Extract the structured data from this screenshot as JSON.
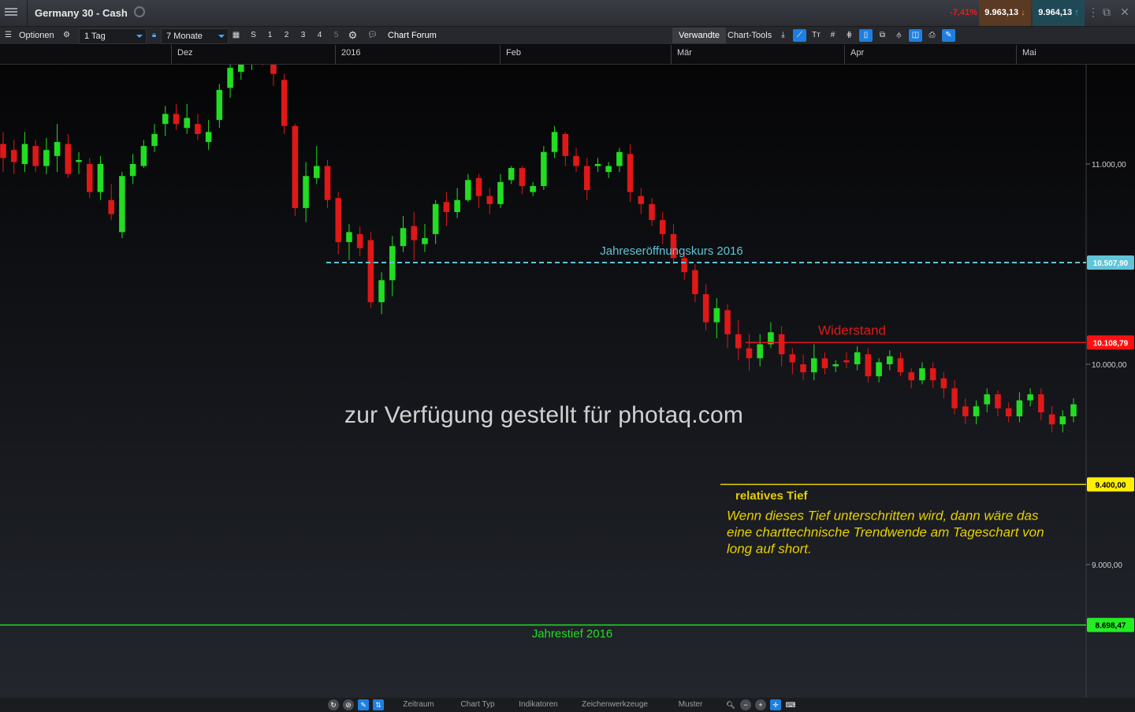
{
  "header": {
    "title": "Germany 30 - Cash",
    "change": "-7,41%",
    "bid": "9.963,13",
    "ask": "9.964,13"
  },
  "toolbar": {
    "options_label": "Optionen",
    "interval": "1 Tag",
    "range": "7 Monate",
    "buttons": [
      "S",
      "1",
      "2",
      "3",
      "4",
      "5"
    ],
    "chart_forum": "Chart Forum",
    "verwandte": "Verwandte",
    "chart_tools": "Chart-Tools"
  },
  "time_axis": [
    "Dez",
    "2016",
    "Feb",
    "Mär",
    "Apr",
    "Mai"
  ],
  "bottom": {
    "zeitraum": "Zeitraum",
    "chart_typ": "Chart Typ",
    "indikatoren": "Indikatoren",
    "zeichenwerkzeuge": "Zeichenwerkzeuge",
    "muster": "Muster"
  },
  "watermark": "zur Verfügung gestellt für photaq.com",
  "colors": {
    "up": "#22dd22",
    "down": "#e01818",
    "opening_line": "#5fc4d8",
    "resistance": "#e01818",
    "relative_low": "#e8d000",
    "year_low": "#22dd22"
  },
  "chart_data": {
    "type": "candlestick",
    "instrument": "Germany 30 - Cash",
    "timeframe": "1 Tag",
    "ylim": [
      8550,
      11320
    ],
    "yticks": [
      {
        "value": 11000,
        "label": "11.000,00"
      },
      {
        "value": 10000,
        "label": "10.000,00"
      },
      {
        "value": 9000,
        "label": "9.000,00"
      }
    ],
    "levels": [
      {
        "name": "Jahreseröffnungskurs 2016",
        "value": 10507.9,
        "label": "10.507,90",
        "style": "dashed",
        "color": "#5fc4d8",
        "tag_bg": "#5fc4d8",
        "tag_color": "#ffffff"
      },
      {
        "name": "Widerstand",
        "value": 10108.79,
        "label": "10.108,79",
        "style": "solid",
        "color": "#e01818",
        "tag_bg": "#ff1010",
        "tag_color": "#ffffff"
      },
      {
        "name": "relatives Tief",
        "value": 9400.0,
        "label": "9.400,00",
        "style": "solid",
        "color": "#e8d000",
        "tag_bg": "#ffee00",
        "tag_color": "#000000"
      },
      {
        "name": "Jahrestief 2016",
        "value": 8698.47,
        "label": "8.698,47",
        "style": "solid",
        "color": "#22dd22",
        "tag_bg": "#22ee22",
        "tag_color": "#000000"
      }
    ],
    "annotations": {
      "opening": "Jahreseröffnungskurs 2016",
      "resistance": "Widerstand",
      "relative_low": "relatives Tief",
      "comment_lines": [
        "Wenn dieses Tief unterschritten wird, dann wäre das",
        "eine charttechnische Trendwende am Tageschart von",
        "long auf short."
      ],
      "year_low": "Jahrestief 2016"
    },
    "candles": [
      [
        11100,
        11030,
        11160,
        10960
      ],
      [
        11070,
        11010,
        11120,
        10950
      ],
      [
        11000,
        11100,
        11160,
        10960
      ],
      [
        11090,
        10990,
        11120,
        10960
      ],
      [
        10990,
        11070,
        11130,
        10950
      ],
      [
        11040,
        11110,
        11200,
        10960
      ],
      [
        11100,
        10950,
        11150,
        10930
      ],
      [
        11010,
        11020,
        11060,
        10950
      ],
      [
        11000,
        10860,
        11030,
        10830
      ],
      [
        10860,
        11000,
        11040,
        10820
      ],
      [
        10820,
        10750,
        10900,
        10720
      ],
      [
        10660,
        10940,
        10960,
        10630
      ],
      [
        10940,
        11000,
        11050,
        10900
      ],
      [
        10990,
        11090,
        11120,
        10980
      ],
      [
        11090,
        11150,
        11200,
        11060
      ],
      [
        11200,
        11250,
        11290,
        11140
      ],
      [
        11250,
        11200,
        11300,
        11170
      ],
      [
        11180,
        11230,
        11300,
        11150
      ],
      [
        11200,
        11150,
        11250,
        11120
      ],
      [
        11110,
        11160,
        11220,
        11070
      ],
      [
        11220,
        11370,
        11400,
        11180
      ],
      [
        11380,
        11480,
        11520,
        11330
      ],
      [
        11460,
        11530,
        11560,
        11420
      ],
      [
        11520,
        11580,
        11640,
        11470
      ],
      [
        11580,
        11520,
        11620,
        11490
      ],
      [
        11540,
        11450,
        11590,
        11390
      ],
      [
        11420,
        11190,
        11450,
        11150
      ],
      [
        11190,
        10780,
        11200,
        10740
      ],
      [
        10780,
        10940,
        11010,
        10710
      ],
      [
        10930,
        10990,
        11090,
        10900
      ],
      [
        10990,
        10820,
        11020,
        10780
      ],
      [
        10830,
        10610,
        10860,
        10550
      ],
      [
        10610,
        10660,
        10700,
        10520
      ],
      [
        10650,
        10580,
        10690,
        10540
      ],
      [
        10620,
        10310,
        10660,
        10280
      ],
      [
        10310,
        10420,
        10460,
        10250
      ],
      [
        10420,
        10590,
        10640,
        10340
      ],
      [
        10590,
        10680,
        10740,
        10560
      ],
      [
        10690,
        10620,
        10760,
        10520
      ],
      [
        10600,
        10630,
        10700,
        10560
      ],
      [
        10650,
        10800,
        10820,
        10600
      ],
      [
        10810,
        10760,
        10860,
        10690
      ],
      [
        10760,
        10820,
        10880,
        10730
      ],
      [
        10820,
        10920,
        10950,
        10810
      ],
      [
        10930,
        10840,
        10950,
        10780
      ],
      [
        10840,
        10800,
        10880,
        10750
      ],
      [
        10800,
        10910,
        10950,
        10780
      ],
      [
        10920,
        10980,
        10990,
        10900
      ],
      [
        10980,
        10890,
        10990,
        10850
      ],
      [
        10860,
        10890,
        10910,
        10840
      ],
      [
        10890,
        11060,
        11090,
        10870
      ],
      [
        11060,
        11160,
        11190,
        11030
      ],
      [
        11150,
        11040,
        11160,
        10990
      ],
      [
        11040,
        10990,
        11080,
        10960
      ],
      [
        10990,
        10870,
        11030,
        10820
      ],
      [
        10990,
        11000,
        11030,
        10960
      ],
      [
        10960,
        10990,
        11010,
        10930
      ],
      [
        10990,
        11060,
        11080,
        10960
      ],
      [
        11050,
        10860,
        11100,
        10810
      ],
      [
        10840,
        10800,
        10880,
        10750
      ],
      [
        10800,
        10720,
        10830,
        10690
      ],
      [
        10720,
        10650,
        10760,
        10600
      ],
      [
        10650,
        10530,
        10700,
        10500
      ],
      [
        10530,
        10460,
        10560,
        10420
      ],
      [
        10470,
        10350,
        10500,
        10310
      ],
      [
        10350,
        10210,
        10400,
        10170
      ],
      [
        10210,
        10280,
        10330,
        10130
      ],
      [
        10270,
        10150,
        10300,
        10080
      ],
      [
        10150,
        10080,
        10220,
        10020
      ],
      [
        10080,
        10030,
        10150,
        9970
      ],
      [
        10030,
        10100,
        10150,
        9990
      ],
      [
        10100,
        10160,
        10210,
        10080
      ],
      [
        10150,
        10050,
        10190,
        9990
      ],
      [
        10050,
        10010,
        10080,
        9950
      ],
      [
        10000,
        9960,
        10050,
        9920
      ],
      [
        9960,
        10030,
        10100,
        9920
      ],
      [
        10030,
        9980,
        10060,
        9950
      ],
      [
        9990,
        10000,
        10020,
        9960
      ],
      [
        10020,
        10010,
        10060,
        9980
      ],
      [
        10000,
        10060,
        10090,
        9970
      ],
      [
        10050,
        9940,
        10080,
        9910
      ],
      [
        9940,
        10010,
        10030,
        9910
      ],
      [
        10000,
        10040,
        10070,
        9970
      ],
      [
        10030,
        9960,
        10060,
        9940
      ],
      [
        9960,
        9920,
        9980,
        9880
      ],
      [
        9920,
        9980,
        10010,
        9900
      ],
      [
        9980,
        9920,
        10010,
        9880
      ],
      [
        9930,
        9880,
        9960,
        9830
      ],
      [
        9880,
        9780,
        9920,
        9750
      ],
      [
        9790,
        9740,
        9830,
        9700
      ],
      [
        9740,
        9790,
        9820,
        9700
      ],
      [
        9800,
        9850,
        9880,
        9760
      ],
      [
        9850,
        9780,
        9870,
        9740
      ],
      [
        9780,
        9740,
        9810,
        9710
      ],
      [
        9740,
        9820,
        9860,
        9710
      ],
      [
        9820,
        9850,
        9880,
        9790
      ],
      [
        9850,
        9760,
        9880,
        9720
      ],
      [
        9750,
        9700,
        9790,
        9660
      ],
      [
        9700,
        9740,
        9770,
        9660
      ],
      [
        9740,
        9800,
        9830,
        9710
      ]
    ]
  }
}
